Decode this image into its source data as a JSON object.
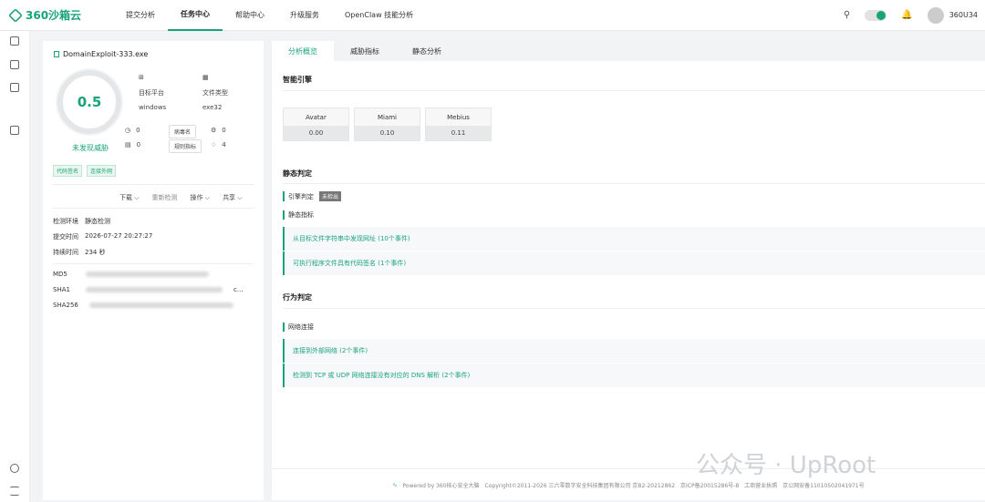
{
  "header": {
    "brand": "360沙箱云",
    "nav": [
      "提交分析",
      "任务中心",
      "帮助中心",
      "升级服务",
      "OpenClaw 技能分析"
    ],
    "active_nav": "任务中心",
    "username": "360U34"
  },
  "file": {
    "name": "DomainExploit-333.exe",
    "score": "0.5",
    "verdict": "未发现威胁",
    "platform_label": "目标平台",
    "platform": "windows",
    "type_label": "文件类型",
    "type": "exe32",
    "stat1": "0",
    "stat2": "0",
    "virus_name_btn": "病毒名",
    "rule_btn": "规则指标",
    "stat3": "0",
    "stat4": "4",
    "tags": [
      "代码签名",
      "连接外网"
    ]
  },
  "actions": {
    "download": "下载",
    "redetect": "重新检测",
    "operate": "操作",
    "share": "共享"
  },
  "env": {
    "env_label": "检测环境",
    "env_value": "静态检测",
    "submit_label": "提交时间",
    "submit_value": "2026-07-27 20:27:27",
    "duration_label": "持续时间",
    "duration_value": "234 秒"
  },
  "hashes": {
    "md5_label": "MD5",
    "sha1_label": "SHA1",
    "sha256_label": "SHA256",
    "sha1_tail": "c…"
  },
  "tabs": [
    "分析概览",
    "威胁指标",
    "静态分析"
  ],
  "engines_section": {
    "title": "智能引擎",
    "engines": [
      {
        "name": "Avatar",
        "value": "0.00"
      },
      {
        "name": "Miami",
        "value": "0.10"
      },
      {
        "name": "Mebius",
        "value": "0.11"
      }
    ]
  },
  "static_section": {
    "title": "静态判定",
    "engine_label": "引擎判定",
    "engine_badge": "未检出",
    "indicator_label": "静态指标",
    "events": [
      "从目标文件字符串中发现网址 (10个事件)",
      "可执行程序文件具有代码签名 (1个事件)"
    ]
  },
  "behavior_section": {
    "title": "行为判定",
    "net_label": "网络连接",
    "events": [
      "连接到外部网络 (2个事件)",
      "检测到 TCP 或 UDP 网络连接没有对应的 DNS 解析 (2个事件)"
    ]
  },
  "footer": {
    "powered": "Powered by 360核心安全大脑",
    "copyright": "Copyright©2011-2026 三六零数字安全科技集团有限公司 京B2-20212862",
    "icp": "京ICP备20015286号-8",
    "license": "工商营业执照",
    "police": "京公网安备11010502041971号"
  },
  "watermark": "公众号 · UpRoot"
}
